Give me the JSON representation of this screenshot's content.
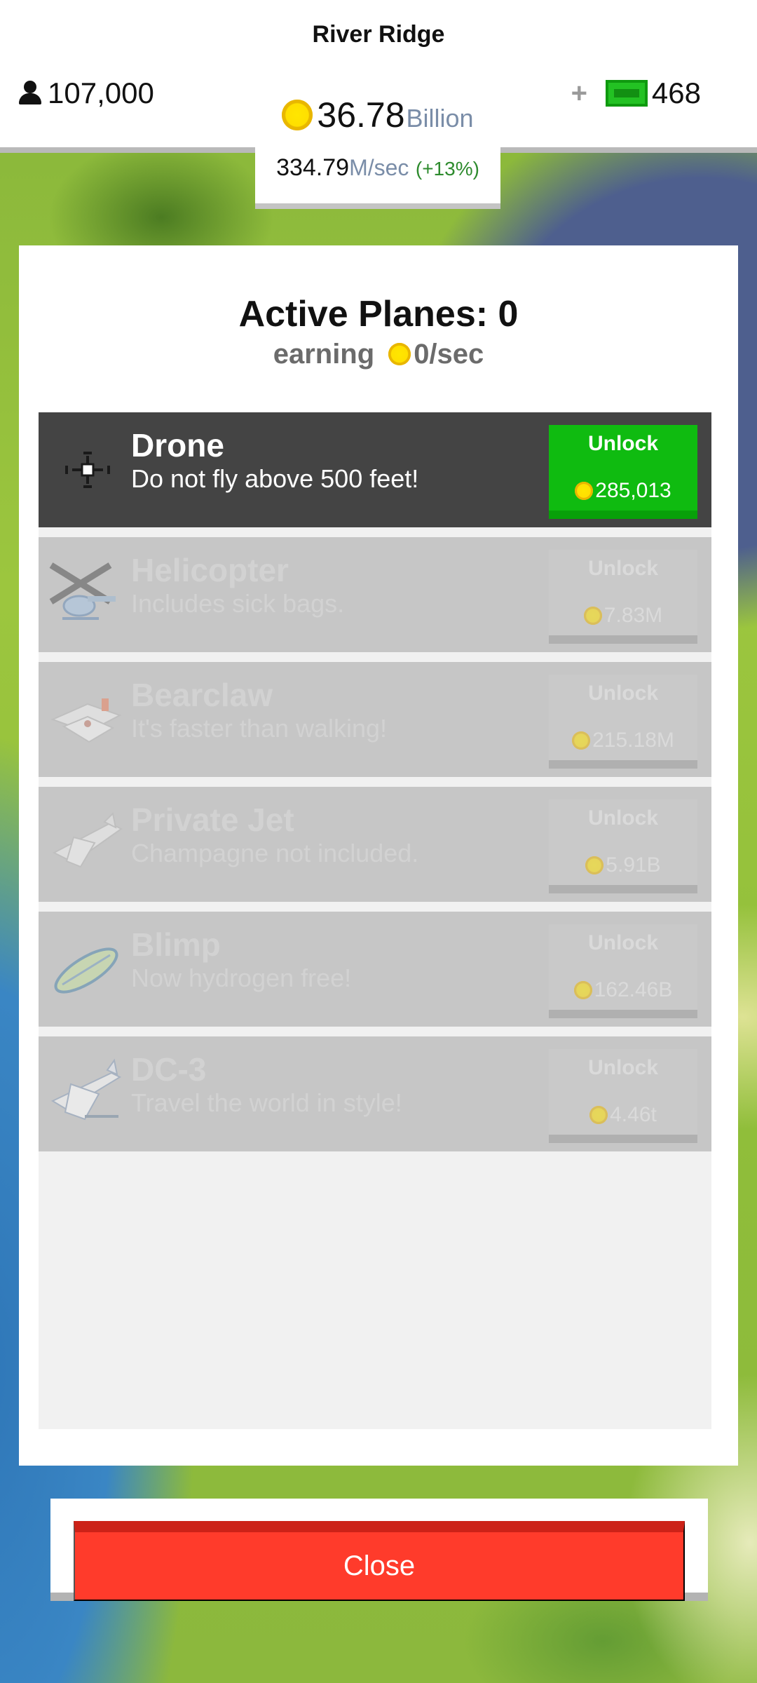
{
  "header": {
    "town_name": "River Ridge",
    "population": "107,000",
    "gems": "468",
    "money_value": "36.78",
    "money_unit": "Billion",
    "rate_value": "334.79",
    "rate_unit": "M/sec",
    "rate_boost": "(+13%)"
  },
  "panel": {
    "title": "Active Planes: 0",
    "earning_label": "earning",
    "earning_value": "0/sec"
  },
  "planes": [
    {
      "name": "Drone",
      "description": "Do not fly above 500 feet!",
      "unlock_label": "Unlock",
      "price": "285,013",
      "icon": "drone-icon",
      "available": true
    },
    {
      "name": "Helicopter",
      "description": "Includes sick bags.",
      "unlock_label": "Unlock",
      "price": "7.83M",
      "icon": "helicopter-icon",
      "available": false
    },
    {
      "name": "Bearclaw",
      "description": "It's faster than walking!",
      "unlock_label": "Unlock",
      "price": "215.18M",
      "icon": "bearclaw-plane-icon",
      "available": false
    },
    {
      "name": "Private Jet",
      "description": "Champagne not included.",
      "unlock_label": "Unlock",
      "price": "5.91B",
      "icon": "private-jet-icon",
      "available": false
    },
    {
      "name": "Blimp",
      "description": "Now hydrogen free!",
      "unlock_label": "Unlock",
      "price": "162.46B",
      "icon": "blimp-icon",
      "available": false
    },
    {
      "name": "DC-3",
      "description": "Travel the world in style!",
      "unlock_label": "Unlock",
      "price": "4.46t",
      "icon": "dc3-plane-icon",
      "available": false
    }
  ],
  "footer": {
    "close_label": "Close"
  },
  "colors": {
    "unlock_available": "#0fbb10",
    "close_button": "#ff3b2b",
    "active_row": "#444444",
    "locked_row": "#c6c6c6",
    "coin": "#ffdf00"
  }
}
